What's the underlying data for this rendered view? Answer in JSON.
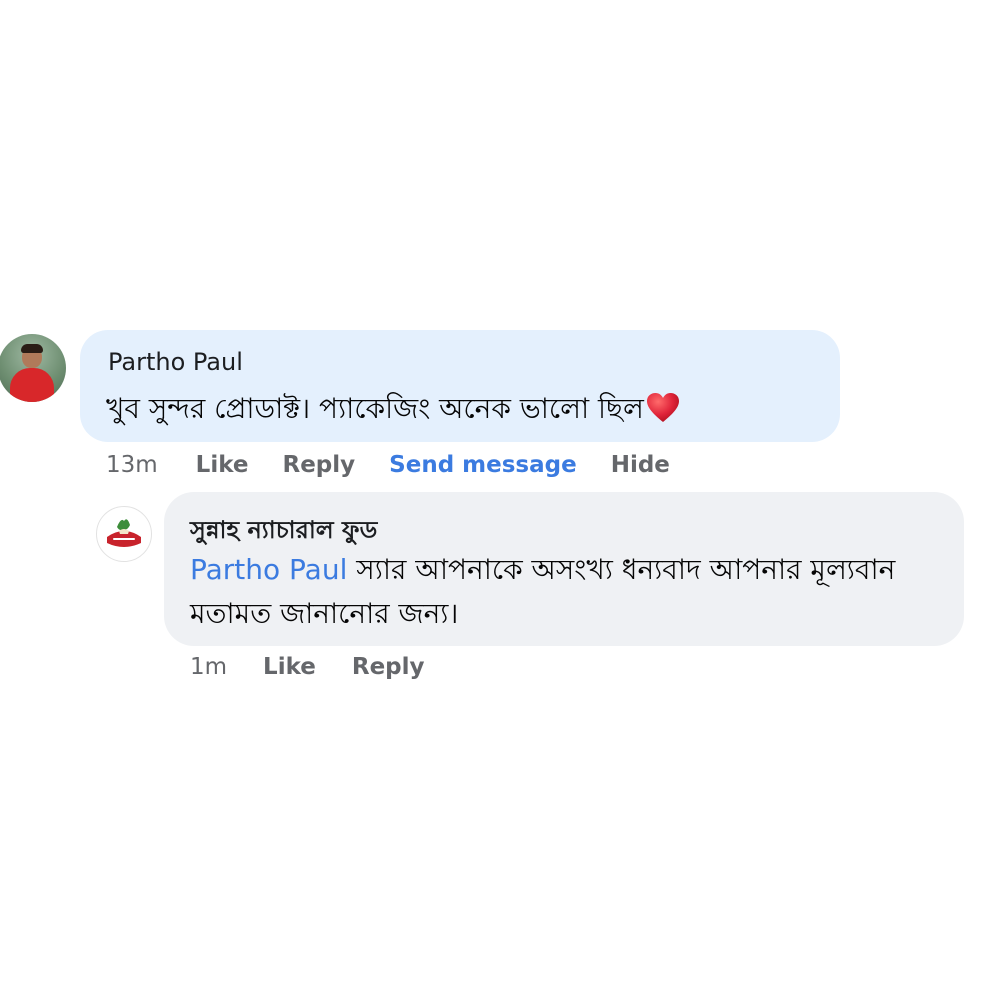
{
  "main_comment": {
    "author": "Partho Paul",
    "text": "খুব সুন্দর প্রোডাক্ট। প্যাকেজিং অনেক ভালো ছিল",
    "time": "13m",
    "actions": {
      "like": "Like",
      "reply": "Reply",
      "send_message": "Send message",
      "hide": "Hide"
    }
  },
  "reply_comment": {
    "author": "সুন্নাহ ন্যাচারাল ফুড",
    "mention": "Partho Paul",
    "text": " স্যার আপনাকে অসংখ্য ধন্যবাদ আপনার মূল্যবান মতামত জানানোর জন্য।",
    "time": "1m",
    "actions": {
      "like": "Like",
      "reply": "Reply"
    }
  },
  "colors": {
    "main_bubble": "#e4f0fd",
    "reply_bubble": "#eff1f4",
    "link_blue": "#3b7be0",
    "meta_gray": "#65676b",
    "heart_red": "#e0243a"
  },
  "icons": {
    "reaction": "heart-icon"
  }
}
